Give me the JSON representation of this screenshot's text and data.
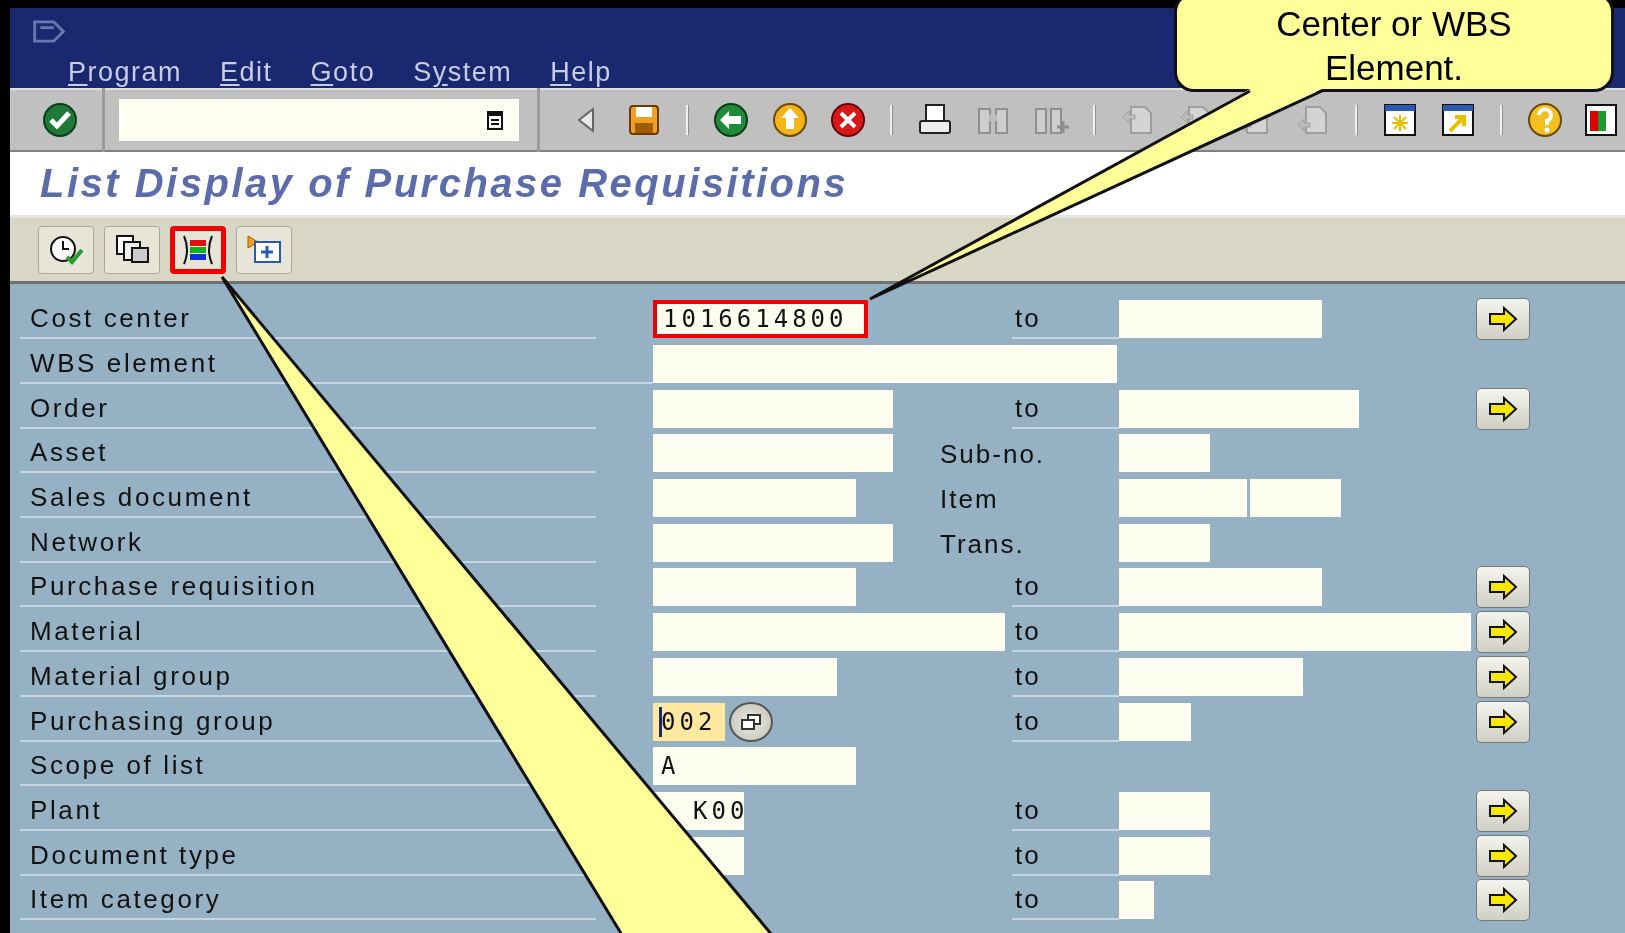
{
  "menu": [
    {
      "key": "P",
      "rest": "rogram"
    },
    {
      "key": "E",
      "rest": "dit"
    },
    {
      "key": "G",
      "rest": "oto"
    },
    {
      "lead": "S",
      "key": "y",
      "rest": "stem"
    },
    {
      "key": "H",
      "rest": "elp"
    }
  ],
  "toolbar": [
    {
      "kind": "check",
      "disabled": false
    },
    {
      "kind": "command-field",
      "disabled": false
    },
    {
      "kind": "back-triangle",
      "disabled": false
    },
    {
      "kind": "save",
      "disabled": false
    },
    {
      "kind": "separator",
      "disabled": false
    },
    {
      "kind": "back",
      "disabled": false
    },
    {
      "kind": "up",
      "disabled": false
    },
    {
      "kind": "cancel",
      "disabled": false
    },
    {
      "kind": "separator",
      "disabled": false
    },
    {
      "kind": "print",
      "disabled": false
    },
    {
      "kind": "find",
      "disabled": true
    },
    {
      "kind": "find-next",
      "disabled": true
    },
    {
      "kind": "separator",
      "disabled": false
    },
    {
      "kind": "page-first",
      "disabled": true
    },
    {
      "kind": "page-prev",
      "disabled": true
    },
    {
      "kind": "page-next",
      "disabled": true
    },
    {
      "kind": "page-last",
      "disabled": true
    },
    {
      "kind": "separator",
      "disabled": false
    },
    {
      "kind": "new-session",
      "disabled": false
    },
    {
      "kind": "shortcut",
      "disabled": false
    },
    {
      "kind": "separator",
      "disabled": false
    },
    {
      "kind": "help",
      "disabled": false
    },
    {
      "kind": "layout",
      "disabled": false
    }
  ],
  "title": "List Display of Purchase Requisitions",
  "app_toolbar": [
    {
      "kind": "execute",
      "highlighted": false
    },
    {
      "kind": "variants",
      "highlighted": false
    },
    {
      "kind": "dynamic-selections",
      "highlighted": true
    },
    {
      "kind": "more-selections",
      "highlighted": false
    }
  ],
  "rows": [
    {
      "label": "Cost center",
      "low": {
        "value": "1016614800",
        "highlighted": true,
        "focused": false
      },
      "mid": {
        "text": "to",
        "kind": "range"
      },
      "high": [
        {
          "highlighted": false
        }
      ],
      "multiple": true,
      "search_help": false
    },
    {
      "label": "WBS element",
      "low": {
        "highlighted": false,
        "focused": false
      },
      "high": [],
      "multiple": false,
      "search_help": false
    },
    {
      "label": "Order",
      "low": {
        "highlighted": false,
        "focused": false
      },
      "mid": {
        "text": "to",
        "kind": "range"
      },
      "high": [
        {
          "highlighted": false
        }
      ],
      "multiple": true,
      "search_help": false
    },
    {
      "label": "Asset",
      "low": {
        "highlighted": false,
        "focused": false
      },
      "mid": {
        "text": "Sub-no.",
        "kind": "label"
      },
      "high": [
        {
          "highlighted": false
        }
      ],
      "multiple": false,
      "search_help": false
    },
    {
      "label": "Sales document",
      "low": {
        "highlighted": false,
        "focused": false
      },
      "mid": {
        "text": "Item",
        "kind": "label"
      },
      "high": [
        {
          "highlighted": false
        },
        {
          "highlighted": false
        }
      ],
      "multiple": false,
      "search_help": false
    },
    {
      "label": "Network",
      "low": {
        "highlighted": false,
        "focused": false
      },
      "mid": {
        "text": "Trans.",
        "kind": "label"
      },
      "high": [
        {
          "highlighted": false
        }
      ],
      "multiple": false,
      "search_help": false
    },
    {
      "label": "Purchase requisition",
      "low": {
        "highlighted": false,
        "focused": false
      },
      "mid": {
        "text": "to",
        "kind": "range"
      },
      "high": [
        {
          "highlighted": false
        }
      ],
      "multiple": true,
      "search_help": false
    },
    {
      "label": "Material",
      "low": {
        "highlighted": false,
        "focused": false
      },
      "mid": {
        "text": "to",
        "kind": "range"
      },
      "high": [
        {
          "highlighted": false
        }
      ],
      "multiple": true,
      "search_help": false
    },
    {
      "label": "Material group",
      "low": {
        "highlighted": false,
        "focused": false
      },
      "mid": {
        "text": "to",
        "kind": "range"
      },
      "high": [
        {
          "highlighted": false
        }
      ],
      "multiple": true,
      "search_help": false
    },
    {
      "label": "Purchasing group",
      "low": {
        "value": "002",
        "highlighted": false,
        "focused": true
      },
      "mid": {
        "text": "to",
        "kind": "range"
      },
      "high": [
        {
          "highlighted": false
        }
      ],
      "multiple": true,
      "search_help": true
    },
    {
      "label": "Scope of list",
      "low": {
        "value": "A",
        "highlighted": false,
        "focused": false
      },
      "high": [],
      "multiple": false,
      "search_help": false
    },
    {
      "label": "Plant",
      "low": {
        "value": "K00",
        "highlighted": false,
        "focused": false
      },
      "mid": {
        "text": "to",
        "kind": "range"
      },
      "high": [
        {
          "highlighted": false
        }
      ],
      "multiple": true,
      "search_help": false
    },
    {
      "label": "Document type",
      "low": {
        "highlighted": false,
        "focused": false
      },
      "mid": {
        "text": "to",
        "kind": "range"
      },
      "high": [
        {
          "highlighted": false
        }
      ],
      "multiple": true,
      "search_help": false
    },
    {
      "label": "Item category",
      "mid": {
        "text": "to",
        "kind": "range"
      },
      "high": [
        {
          "highlighted": false
        }
      ],
      "multiple": true,
      "search_help": false
    }
  ],
  "callout": {
    "text": "Center or WBS Element."
  }
}
